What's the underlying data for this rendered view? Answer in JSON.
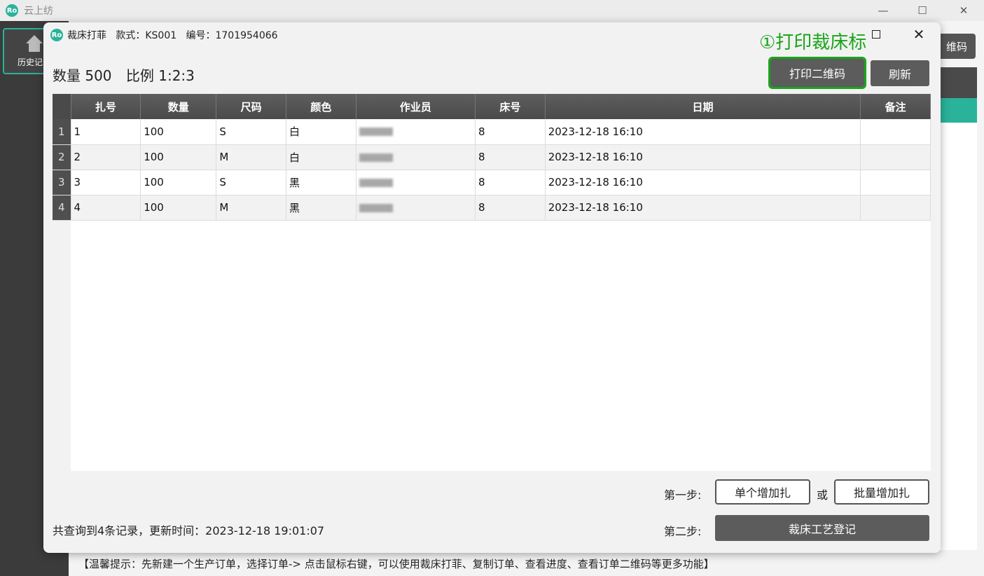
{
  "main_window": {
    "title": "云上纺",
    "logo_text": "Ro",
    "minimize": "—",
    "maximize": "☐",
    "close": "✕"
  },
  "sidebar": {
    "items": [
      {
        "label": "历史记录",
        "icon": "home-icon"
      }
    ]
  },
  "background": {
    "button_partial": "维码",
    "tip": "【温馨提示：先新建一个生产订单，选择订单-> 点击鼠标右键，可以使用裁床打菲、复制订单、查看进度、查看订单二维码等更多功能】"
  },
  "dialog": {
    "logo_text": "Ro",
    "title": "裁床打菲   款式：KS001   编号：1701954066",
    "close": "✕",
    "annotation": "①打印裁床标",
    "summary": {
      "quantity": "数量 500",
      "ratio": "比例 1:2:3"
    },
    "buttons": {
      "print_qr": "打印二维码",
      "refresh": "刷新",
      "single_add": "单个增加扎",
      "batch_add": "批量增加扎",
      "register": "裁床工艺登记"
    },
    "steps": {
      "step1": "第一步:",
      "or": "或",
      "step2": "第二步:"
    },
    "record_info": "共查询到4条记录，更新时间：2023-12-18 19:01:07",
    "table": {
      "columns": [
        "扎号",
        "数量",
        "尺码",
        "颜色",
        "作业员",
        "床号",
        "日期",
        "备注"
      ],
      "rows": [
        {
          "num": "1",
          "bundle": "1",
          "qty": "100",
          "size": "S",
          "color": "白",
          "bed": "8",
          "date": "2023-12-18 16:10",
          "note": ""
        },
        {
          "num": "2",
          "bundle": "2",
          "qty": "100",
          "size": "M",
          "color": "白",
          "bed": "8",
          "date": "2023-12-18 16:10",
          "note": ""
        },
        {
          "num": "3",
          "bundle": "3",
          "qty": "100",
          "size": "S",
          "color": "黑",
          "bed": "8",
          "date": "2023-12-18 16:10",
          "note": ""
        },
        {
          "num": "4",
          "bundle": "4",
          "qty": "100",
          "size": "M",
          "color": "黑",
          "bed": "8",
          "date": "2023-12-18 16:10",
          "note": ""
        }
      ]
    }
  },
  "colors": {
    "accent_teal": "#2bb29a",
    "annotation_green": "#1aa51a",
    "button_dark": "#5c5c5c",
    "sidebar_bg": "#3b3b3b"
  }
}
